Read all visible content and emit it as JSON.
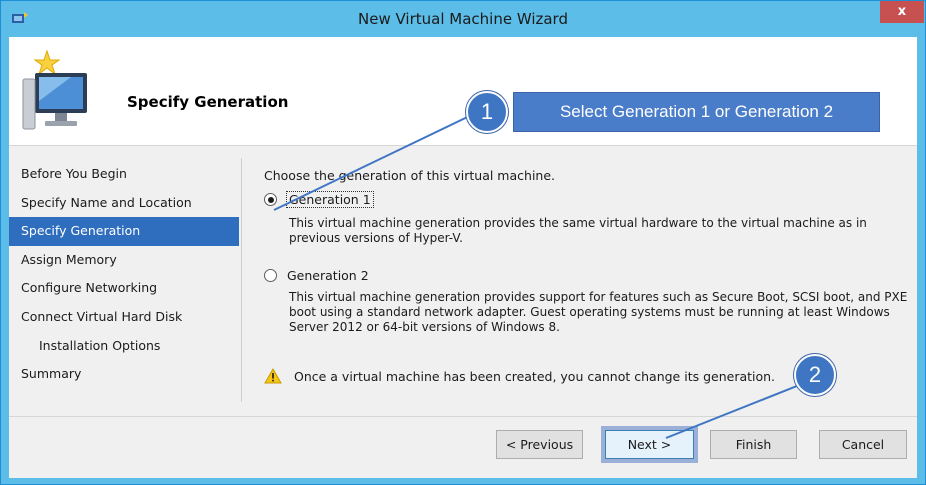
{
  "window": {
    "title": "New Virtual Machine Wizard",
    "close_label": "x"
  },
  "header": {
    "title": "Specify Generation"
  },
  "sidebar": {
    "items": [
      {
        "label": "Before You Begin"
      },
      {
        "label": "Specify Name and Location"
      },
      {
        "label": "Specify Generation",
        "active": true
      },
      {
        "label": "Assign Memory"
      },
      {
        "label": "Configure Networking"
      },
      {
        "label": "Connect Virtual Hard Disk"
      },
      {
        "label": "Installation Options",
        "indent": true
      },
      {
        "label": "Summary"
      }
    ]
  },
  "main": {
    "prompt": "Choose the generation of this virtual machine.",
    "options": [
      {
        "label": "Generation 1",
        "selected": true,
        "description": "This virtual machine generation provides the same virtual hardware to the virtual machine as in previous versions of Hyper-V."
      },
      {
        "label": "Generation 2",
        "selected": false,
        "description": "This virtual machine generation provides support for features such as Secure Boot, SCSI boot, and PXE boot using a standard network adapter. Guest operating systems must be running at least Windows Server 2012 or 64-bit versions of Windows 8."
      }
    ],
    "warning": "Once a virtual machine has been created, you cannot change its generation."
  },
  "buttons": {
    "previous": "< Previous",
    "next": "Next >",
    "finish": "Finish",
    "cancel": "Cancel"
  },
  "annotations": {
    "callout_text": "Select Generation 1 or Generation 2",
    "step1": "1",
    "step2": "2"
  },
  "colors": {
    "titlebar": "#5bbde8",
    "sidebar_active": "#2f6ebf",
    "annotation": "#4a7dc9",
    "close_button": "#c75050"
  }
}
